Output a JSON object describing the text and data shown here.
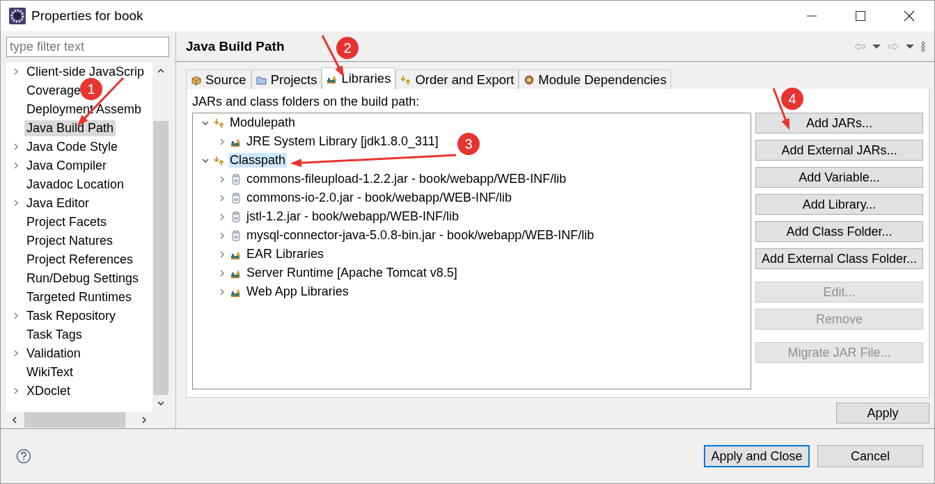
{
  "window": {
    "title": "Properties for book"
  },
  "sidebar": {
    "filter": {
      "placeholder": "type filter text"
    },
    "items": [
      {
        "label": "Client-side JavaScrip",
        "expandable": true,
        "selected": false
      },
      {
        "label": "Coverage",
        "expandable": false,
        "selected": false
      },
      {
        "label": "Deployment Assemb",
        "expandable": false,
        "selected": false
      },
      {
        "label": "Java Build Path",
        "expandable": false,
        "selected": true
      },
      {
        "label": "Java Code Style",
        "expandable": true,
        "selected": false
      },
      {
        "label": "Java Compiler",
        "expandable": true,
        "selected": false
      },
      {
        "label": "Javadoc Location",
        "expandable": false,
        "selected": false
      },
      {
        "label": "Java Editor",
        "expandable": true,
        "selected": false
      },
      {
        "label": "Project Facets",
        "expandable": false,
        "selected": false
      },
      {
        "label": "Project Natures",
        "expandable": false,
        "selected": false
      },
      {
        "label": "Project References",
        "expandable": false,
        "selected": false
      },
      {
        "label": "Run/Debug Settings",
        "expandable": false,
        "selected": false
      },
      {
        "label": "Targeted Runtimes",
        "expandable": false,
        "selected": false
      },
      {
        "label": "Task Repository",
        "expandable": true,
        "selected": false
      },
      {
        "label": "Task Tags",
        "expandable": false,
        "selected": false
      },
      {
        "label": "Validation",
        "expandable": true,
        "selected": false
      },
      {
        "label": "WikiText",
        "expandable": false,
        "selected": false
      },
      {
        "label": "XDoclet",
        "expandable": true,
        "selected": false
      }
    ]
  },
  "page": {
    "title": "Java Build Path",
    "tabs": [
      {
        "label": "Source",
        "kind": "source",
        "selected": false
      },
      {
        "label": "Projects",
        "kind": "projects",
        "selected": false
      },
      {
        "label": "Libraries",
        "kind": "libraries",
        "selected": true
      },
      {
        "label": "Order and Export",
        "kind": "order",
        "selected": false
      },
      {
        "label": "Module Dependencies",
        "kind": "module",
        "selected": false
      }
    ],
    "description": "JARs and class folders on the build path:",
    "tree": [
      {
        "label": "Modulepath",
        "kind": "container",
        "expanded": true,
        "selected": false,
        "children": [
          {
            "label": "JRE System Library [jdk1.8.0_311]",
            "kind": "library",
            "expanded": false,
            "selected": false
          }
        ]
      },
      {
        "label": "Classpath",
        "kind": "container",
        "expanded": true,
        "selected": true,
        "children": [
          {
            "label": "commons-fileupload-1.2.2.jar - book/webapp/WEB-INF/lib",
            "kind": "jar",
            "expanded": false,
            "selected": false
          },
          {
            "label": "commons-io-2.0.jar - book/webapp/WEB-INF/lib",
            "kind": "jar",
            "expanded": false,
            "selected": false
          },
          {
            "label": "jstl-1.2.jar - book/webapp/WEB-INF/lib",
            "kind": "jar",
            "expanded": false,
            "selected": false
          },
          {
            "label": "mysql-connector-java-5.0.8-bin.jar - book/webapp/WEB-INF/lib",
            "kind": "jar",
            "expanded": false,
            "selected": false
          },
          {
            "label": "EAR Libraries",
            "kind": "library",
            "expanded": false,
            "selected": false
          },
          {
            "label": "Server Runtime [Apache Tomcat v8.5]",
            "kind": "library",
            "expanded": false,
            "selected": false
          },
          {
            "label": "Web App Libraries",
            "kind": "library",
            "expanded": false,
            "selected": false
          }
        ]
      }
    ],
    "buttons": [
      {
        "label": "Add JARs...",
        "disabled": false
      },
      {
        "label": "Add External JARs...",
        "disabled": false
      },
      {
        "label": "Add Variable...",
        "disabled": false
      },
      {
        "label": "Add Library...",
        "disabled": false
      },
      {
        "label": "Add Class Folder...",
        "disabled": false
      },
      {
        "label": "Add External Class Folder...",
        "disabled": false
      },
      {
        "label": "Edit...",
        "disabled": true
      },
      {
        "label": "Remove",
        "disabled": true
      },
      {
        "label": "Migrate JAR File...",
        "disabled": true
      }
    ],
    "apply": "Apply"
  },
  "footer": {
    "buttons": [
      {
        "label": "Apply and Close",
        "default": true
      },
      {
        "label": "Cancel",
        "default": false
      }
    ]
  },
  "annotations": [
    {
      "label": "1"
    },
    {
      "label": "2"
    },
    {
      "label": "3"
    },
    {
      "label": "4"
    }
  ]
}
